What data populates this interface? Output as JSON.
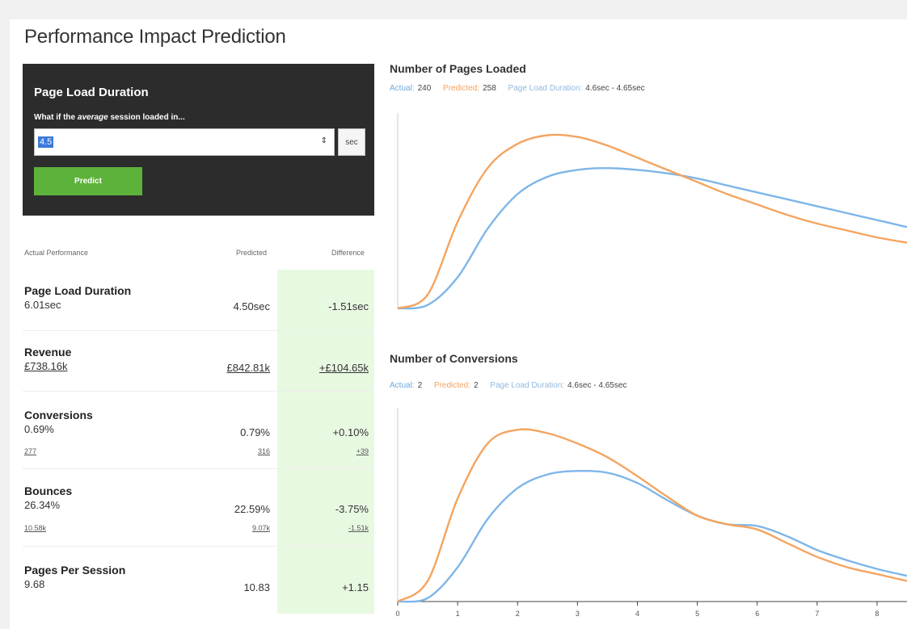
{
  "page_title": "Performance Impact Prediction",
  "form": {
    "title": "Page Load Duration",
    "subtitle_prefix": "What if the ",
    "subtitle_emph": "average",
    "subtitle_suffix": " session loaded in...",
    "input_value": "4.5",
    "spinner_icon": "⇕",
    "unit": "sec",
    "predict_label": "Predict"
  },
  "table": {
    "headers": {
      "actual": "Actual Performance",
      "predicted": "Predicted",
      "difference": "Difference"
    },
    "rows": [
      {
        "name": "Page Load Duration",
        "actual": "6.01sec",
        "predicted": "4.50sec",
        "difference": "-1.51sec"
      },
      {
        "name": "Revenue",
        "actual": "£738.16k",
        "predicted": "£842.81k",
        "difference": "+£104.65k"
      },
      {
        "name": "Conversions",
        "actual": "0.69%",
        "predicted": "0.79%",
        "difference": "+0.10%",
        "actual_sub": "277",
        "predicted_sub": "316",
        "difference_sub": "+39"
      },
      {
        "name": "Bounces",
        "actual": "26.34%",
        "predicted": "22.59%",
        "difference": "-3.75%",
        "actual_sub": "10.58k",
        "predicted_sub": "9.07k",
        "difference_sub": "-1.51k"
      },
      {
        "name": "Pages Per Session",
        "actual": "9.68",
        "predicted": "10.83",
        "difference": "+1.15"
      }
    ]
  },
  "charts": {
    "pages": {
      "title": "Number of Pages Loaded",
      "actual_label": "Actual:",
      "actual_value": "240",
      "predicted_label": "Predicted:",
      "predicted_value": "258",
      "duration_label": "Page Load Duration:",
      "duration_value": "4.6sec - 4.65sec"
    },
    "conversions": {
      "title": "Number of Conversions",
      "actual_label": "Actual:",
      "actual_value": "2",
      "predicted_label": "Predicted:",
      "predicted_value": "2",
      "duration_label": "Page Load Duration:",
      "duration_value": "4.6sec - 4.65sec"
    }
  },
  "colors": {
    "actual": "#7eb6e8",
    "predicted": "#f4a460",
    "accent_green": "#5cb23b",
    "panel": "#2c2c2c",
    "diff_bg": "#e8f9e2"
  },
  "chart_data": [
    {
      "type": "line",
      "title": "Number of Pages Loaded",
      "x": [
        0,
        0.5,
        1,
        1.5,
        2,
        2.5,
        3,
        3.5,
        4,
        4.5,
        5,
        5.5,
        6,
        6.5,
        7,
        7.5,
        8,
        8.5
      ],
      "series": [
        {
          "name": "Actual",
          "values": [
            0,
            2,
            18,
            46,
            66,
            76,
            80,
            81,
            80,
            78,
            75,
            71,
            67,
            63,
            59,
            55,
            51,
            47
          ]
        },
        {
          "name": "Predicted",
          "values": [
            0,
            8,
            50,
            81,
            95,
            100,
            99,
            94,
            87,
            80,
            73,
            66,
            60,
            54,
            49,
            45,
            41,
            38
          ]
        }
      ],
      "ylim": [
        0,
        110
      ],
      "xlim": [
        0,
        8.5
      ]
    },
    {
      "type": "line",
      "title": "Number of Conversions",
      "x": [
        0,
        0.5,
        1,
        1.5,
        2,
        2.5,
        3,
        3.5,
        4,
        4.5,
        5,
        5.5,
        6,
        6.5,
        7,
        7.5,
        8,
        8.5
      ],
      "x_ticks": [
        0,
        1,
        2,
        3,
        4,
        5,
        6,
        7,
        8
      ],
      "series": [
        {
          "name": "Actual",
          "values": [
            0,
            2,
            20,
            48,
            66,
            74,
            76,
            75,
            69,
            59,
            50,
            45,
            44,
            38,
            30,
            24,
            19,
            15
          ]
        },
        {
          "name": "Predicted",
          "values": [
            0,
            12,
            60,
            92,
            100,
            98,
            92,
            84,
            73,
            61,
            50,
            45,
            42,
            34,
            26,
            20,
            16,
            12
          ]
        }
      ],
      "ylim": [
        0,
        110
      ],
      "xlim": [
        0,
        8.5
      ]
    }
  ]
}
